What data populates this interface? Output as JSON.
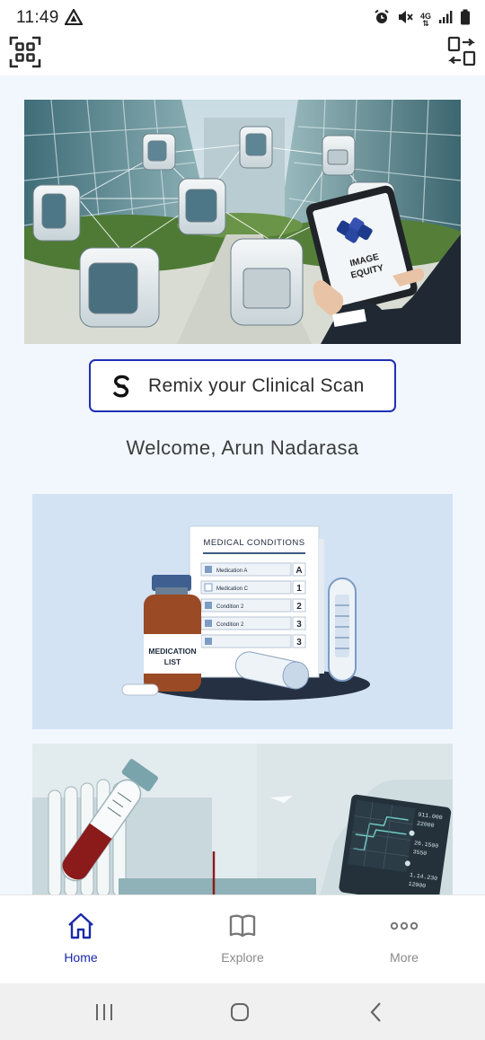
{
  "status_bar": {
    "time": "11:49",
    "network_label": "4G",
    "icons": [
      "navigation-arrow-icon",
      "alarm-icon",
      "mute-icon",
      "network-4g-icon",
      "signal-icon",
      "battery-icon"
    ]
  },
  "app_bar": {
    "left_icon": "qr-scan-icon",
    "right_icon": "switch-account-icon"
  },
  "hero": {
    "tablet_text_line1": "IMAGE",
    "tablet_text_line2": "EQUITY"
  },
  "remix_button": {
    "label": "Remix your Clinical Scan"
  },
  "welcome": {
    "text": "Welcome, Arun Nadarasa"
  },
  "medical_card": {
    "sheet_title": "MEDICAL CONDITIONS",
    "rows": [
      {
        "label": "Medication A",
        "value": "A"
      },
      {
        "label": "Medication C",
        "value": "1"
      },
      {
        "label": "Condition 2",
        "value": "2"
      },
      {
        "label": "Condition 2",
        "value": "3"
      },
      {
        "label": "",
        "value": "3"
      }
    ],
    "bottle_label_line1": "MEDICATION",
    "bottle_label_line2": "LIST"
  },
  "lab_card": {
    "monitor_values": [
      "911.000",
      "22000",
      "26.1500",
      "3550",
      "1.14.230",
      "12000"
    ]
  },
  "bottom_nav": {
    "items": [
      {
        "label": "Home",
        "icon": "home-icon",
        "active": true
      },
      {
        "label": "Explore",
        "icon": "book-icon",
        "active": false
      },
      {
        "label": "More",
        "icon": "more-dots-icon",
        "active": false
      }
    ]
  },
  "system_nav": {
    "icons": [
      "recent-apps-icon",
      "home-circle-icon",
      "back-icon"
    ]
  },
  "colors": {
    "accent": "#1a2aa8",
    "content_bg": "#f1f7fd",
    "card_bg": "#d3e3f4"
  }
}
